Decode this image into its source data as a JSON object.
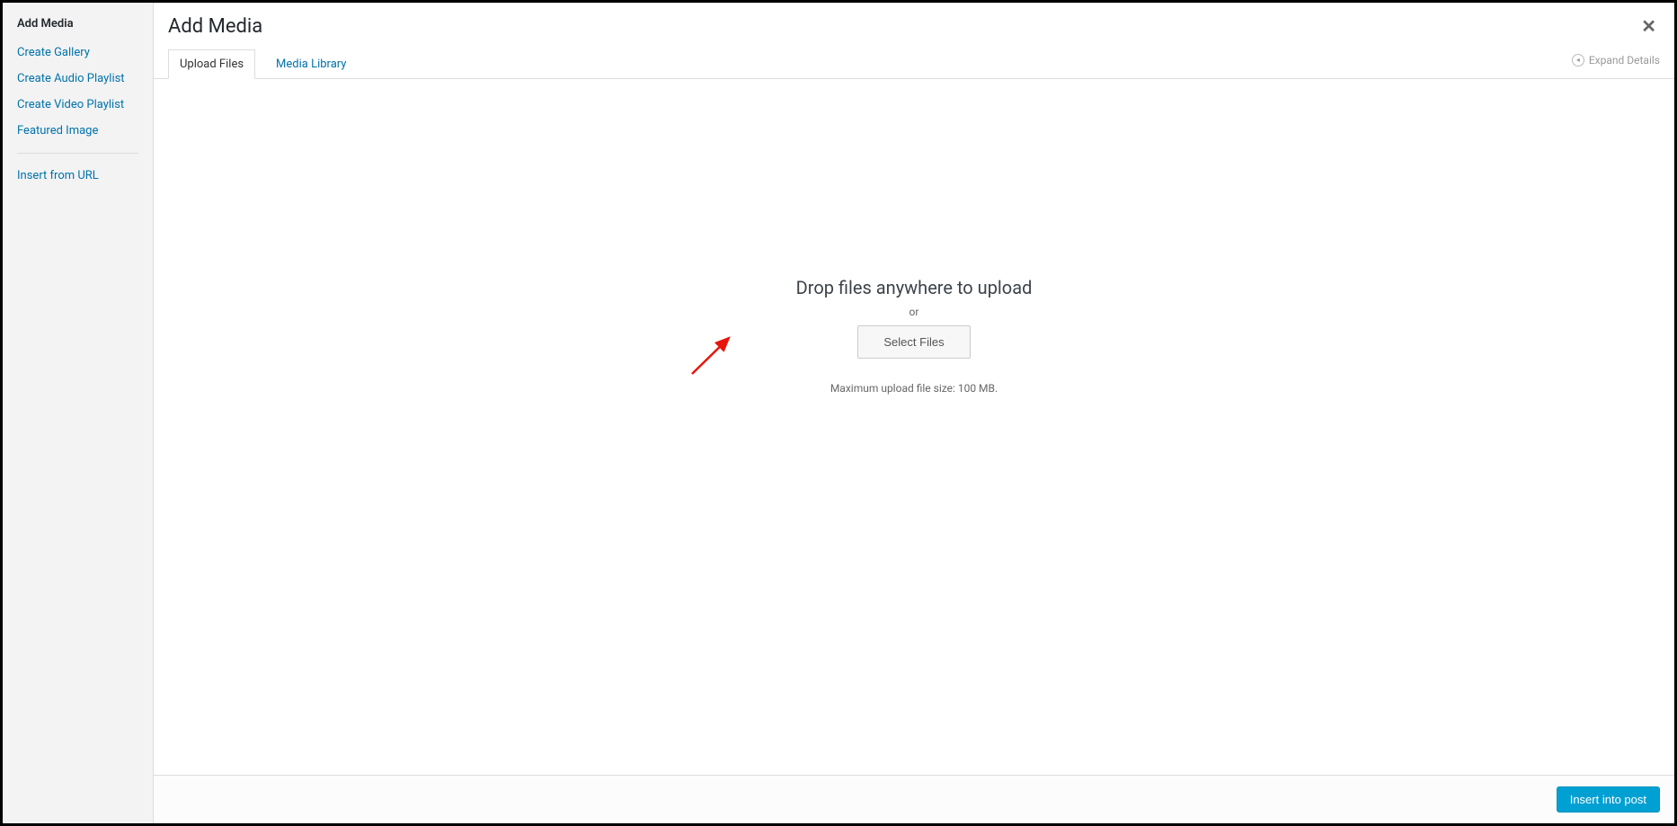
{
  "sidebar": {
    "title": "Add Media",
    "items": [
      {
        "label": "Create Gallery"
      },
      {
        "label": "Create Audio Playlist"
      },
      {
        "label": "Create Video Playlist"
      },
      {
        "label": "Featured Image"
      }
    ],
    "insert_from_url": "Insert from URL"
  },
  "header": {
    "title": "Add Media"
  },
  "tabs": {
    "upload_files": "Upload Files",
    "media_library": "Media Library",
    "expand_details": "Expand Details"
  },
  "upload": {
    "drop_title": "Drop files anywhere to upload",
    "or": "or",
    "select_files": "Select Files",
    "max_upload": "Maximum upload file size: 100 MB."
  },
  "footer": {
    "insert_button": "Insert into post"
  }
}
